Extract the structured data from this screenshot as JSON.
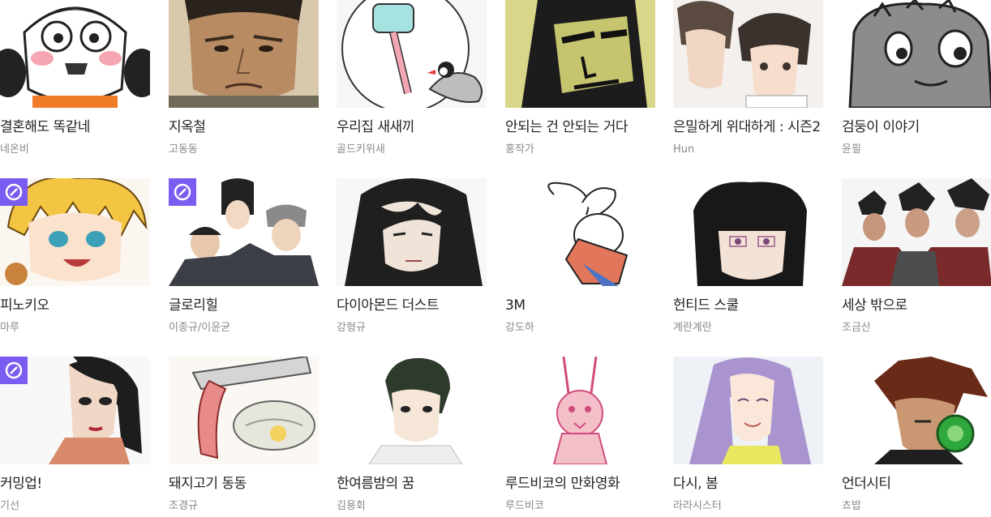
{
  "accent_color": "#7b5cf0",
  "badge_icon": "compass-icon",
  "rows": [
    [
      {
        "title": "결혼해도 똑같네",
        "author": "네온비",
        "badge": false
      },
      {
        "title": "지옥철",
        "author": "고동동",
        "badge": false
      },
      {
        "title": "우리집 새새끼",
        "author": "골드키위새",
        "badge": false
      },
      {
        "title": "안되는 건 안되는 거다",
        "author": "홍작가",
        "badge": false
      },
      {
        "title": "은밀하게 위대하게 : 시즌2",
        "author": "Hun",
        "badge": false
      },
      {
        "title": "검둥이 이야기",
        "author": "윤필",
        "badge": false
      }
    ],
    [
      {
        "title": "피노키오",
        "author": "마루",
        "badge": true
      },
      {
        "title": "글로리힐",
        "author": "이종규/이윤균",
        "badge": true
      },
      {
        "title": "다이아몬드 더스트",
        "author": "강형규",
        "badge": false
      },
      {
        "title": "3M",
        "author": "강도하",
        "badge": false
      },
      {
        "title": "헌티드 스쿨",
        "author": "계란계란",
        "badge": false
      },
      {
        "title": "세상 밖으로",
        "author": "조금산",
        "badge": false
      }
    ],
    [
      {
        "title": "커밍업!",
        "author": "기선",
        "badge": true
      },
      {
        "title": "돼지고기 동동",
        "author": "조경규",
        "badge": false
      },
      {
        "title": "한여름밤의 꿈",
        "author": "김용회",
        "badge": false
      },
      {
        "title": "루드비코의 만화영화",
        "author": "루드비코",
        "badge": false
      },
      {
        "title": "다시, 봄",
        "author": "라라시스터",
        "badge": false
      },
      {
        "title": "언더시티",
        "author": "쵸밥",
        "badge": false
      }
    ]
  ]
}
